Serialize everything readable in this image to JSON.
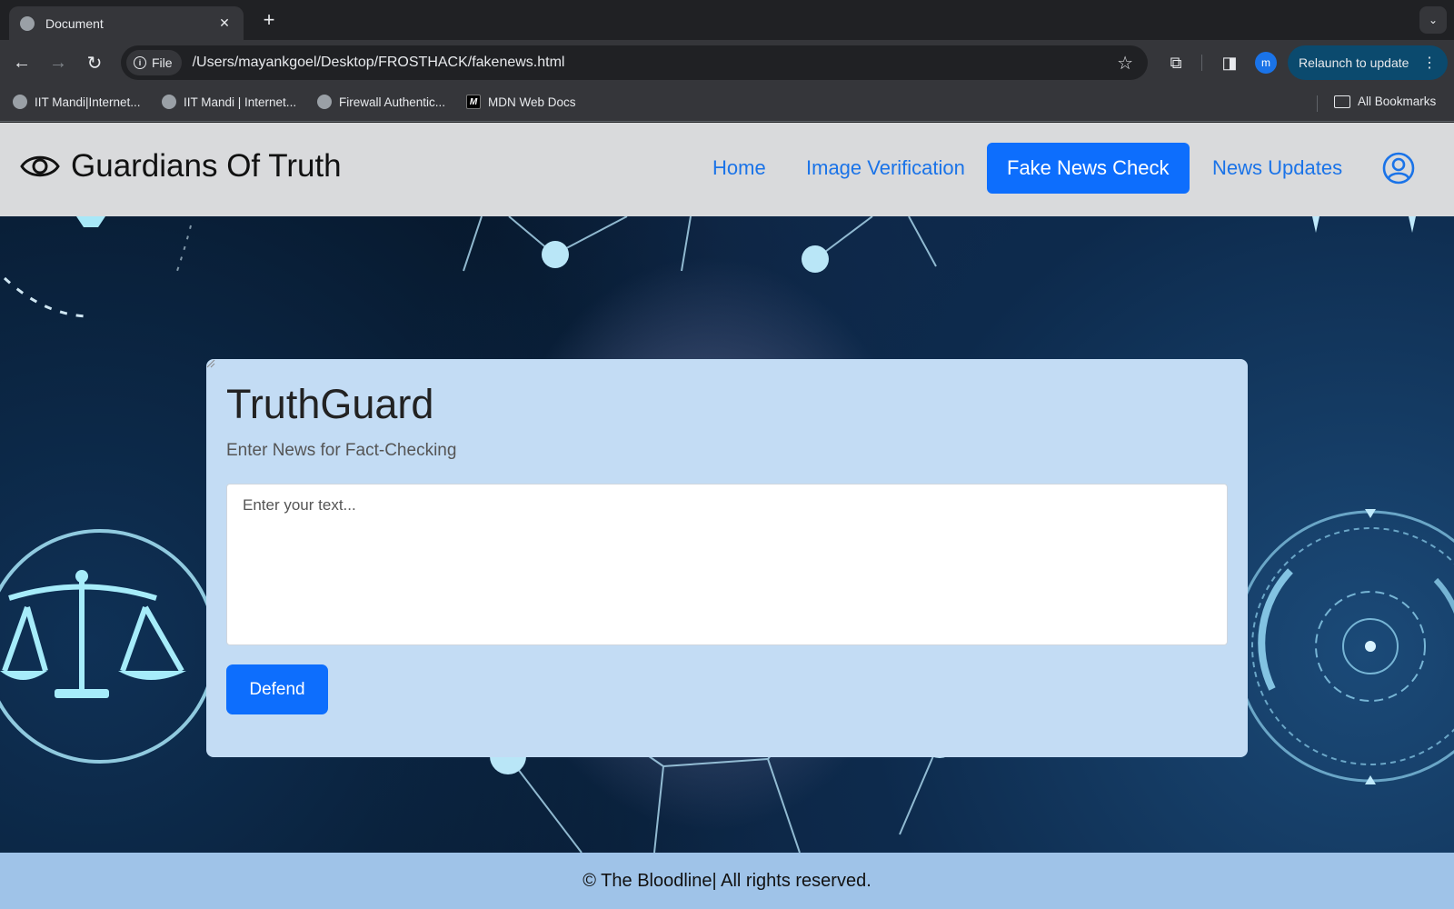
{
  "browser": {
    "tab_title": "Document",
    "omnibox_chip": "File",
    "url": "/Users/mayankgoel/Desktop/FROSTHACK/fakenews.html",
    "profile_initial": "m",
    "relaunch_label": "Relaunch to update",
    "bookmarks": [
      {
        "label": "IIT Mandi|Internet...",
        "icon": "globe-icon"
      },
      {
        "label": "IIT Mandi | Internet...",
        "icon": "globe-icon"
      },
      {
        "label": "Firewall Authentic...",
        "icon": "globe-icon"
      },
      {
        "label": "MDN Web Docs",
        "icon": "mdn-icon"
      }
    ],
    "all_bookmarks_label": "All Bookmarks"
  },
  "site": {
    "brand": "Guardians Of Truth",
    "nav": [
      {
        "label": "Home",
        "active": false
      },
      {
        "label": "Image Verification",
        "active": false
      },
      {
        "label": "Fake News Check",
        "active": true
      },
      {
        "label": "News Updates",
        "active": false
      }
    ]
  },
  "card": {
    "title": "TruthGuard",
    "subtitle": "Enter News for Fact-Checking",
    "textarea_placeholder": "Enter your text...",
    "textarea_value": "",
    "button_label": "Defend"
  },
  "footer": {
    "text": "© The Bloodline| All rights reserved."
  },
  "colors": {
    "accent": "#0d6efd",
    "link": "#1a73e8",
    "card_bg": "#c3dcf4",
    "navbar_bg": "#d9dadc",
    "footer_bg": "#9fc3e8"
  }
}
